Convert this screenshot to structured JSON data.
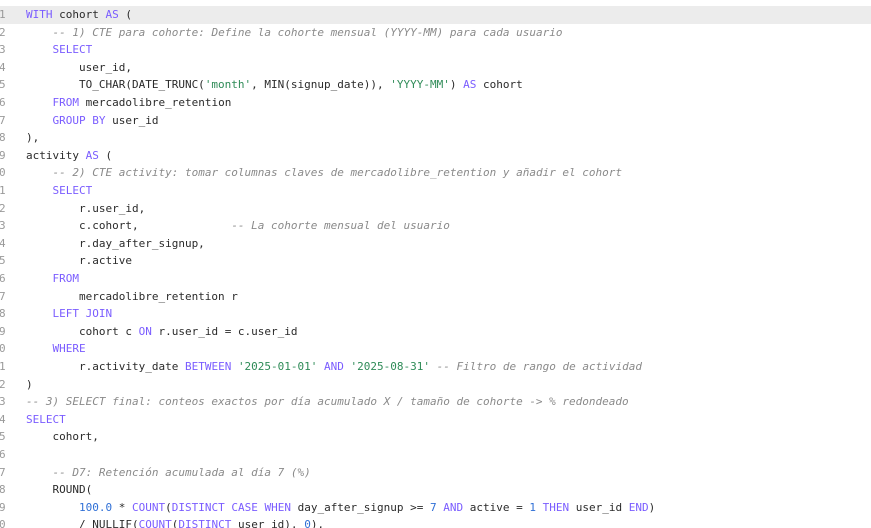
{
  "editor": {
    "current_line": 0,
    "lines": [
      {
        "num": "1",
        "tokens": [
          {
            "t": "kw",
            "v": "WITH"
          },
          {
            "t": "plain",
            "v": " cohort "
          },
          {
            "t": "kw",
            "v": "AS"
          },
          {
            "t": "plain",
            "v": " ("
          }
        ]
      },
      {
        "num": "2",
        "tokens": [
          {
            "t": "plain",
            "v": "    "
          },
          {
            "t": "com",
            "v": "-- 1) CTE para cohorte: Define la cohorte mensual (YYYY-MM) para cada usuario"
          }
        ]
      },
      {
        "num": "3",
        "tokens": [
          {
            "t": "plain",
            "v": "    "
          },
          {
            "t": "kw",
            "v": "SELECT"
          }
        ]
      },
      {
        "num": "4",
        "tokens": [
          {
            "t": "plain",
            "v": "        user_id,"
          }
        ]
      },
      {
        "num": "5",
        "tokens": [
          {
            "t": "plain",
            "v": "        TO_CHAR(DATE_TRUNC("
          },
          {
            "t": "str",
            "v": "'month'"
          },
          {
            "t": "plain",
            "v": ", MIN(signup_date)), "
          },
          {
            "t": "str",
            "v": "'YYYY-MM'"
          },
          {
            "t": "plain",
            "v": ") "
          },
          {
            "t": "kw",
            "v": "AS"
          },
          {
            "t": "plain",
            "v": " cohort"
          }
        ]
      },
      {
        "num": "6",
        "tokens": [
          {
            "t": "plain",
            "v": "    "
          },
          {
            "t": "kw",
            "v": "FROM"
          },
          {
            "t": "plain",
            "v": " mercadolibre_retention"
          }
        ]
      },
      {
        "num": "7",
        "tokens": [
          {
            "t": "plain",
            "v": "    "
          },
          {
            "t": "kw",
            "v": "GROUP BY"
          },
          {
            "t": "plain",
            "v": " user_id"
          }
        ]
      },
      {
        "num": "8",
        "tokens": [
          {
            "t": "plain",
            "v": "),"
          }
        ]
      },
      {
        "num": "9",
        "tokens": [
          {
            "t": "plain",
            "v": "activity "
          },
          {
            "t": "kw",
            "v": "AS"
          },
          {
            "t": "plain",
            "v": " ("
          }
        ]
      },
      {
        "num": "0",
        "tokens": [
          {
            "t": "plain",
            "v": "    "
          },
          {
            "t": "com",
            "v": "-- 2) CTE activity: tomar columnas claves de mercadolibre_retention y añadir el cohort"
          }
        ]
      },
      {
        "num": "1",
        "tokens": [
          {
            "t": "plain",
            "v": "    "
          },
          {
            "t": "kw",
            "v": "SELECT"
          }
        ]
      },
      {
        "num": "2",
        "tokens": [
          {
            "t": "plain",
            "v": "        r.user_id,"
          }
        ]
      },
      {
        "num": "3",
        "tokens": [
          {
            "t": "plain",
            "v": "        c.cohort,              "
          },
          {
            "t": "com",
            "v": "-- La cohorte mensual del usuario"
          }
        ]
      },
      {
        "num": "4",
        "tokens": [
          {
            "t": "plain",
            "v": "        r.day_after_signup,"
          }
        ]
      },
      {
        "num": "5",
        "tokens": [
          {
            "t": "plain",
            "v": "        r.active"
          }
        ]
      },
      {
        "num": "6",
        "tokens": [
          {
            "t": "plain",
            "v": "    "
          },
          {
            "t": "kw",
            "v": "FROM"
          }
        ]
      },
      {
        "num": "7",
        "tokens": [
          {
            "t": "plain",
            "v": "        mercadolibre_retention r"
          }
        ]
      },
      {
        "num": "8",
        "tokens": [
          {
            "t": "plain",
            "v": "    "
          },
          {
            "t": "kw",
            "v": "LEFT JOIN"
          }
        ]
      },
      {
        "num": "9",
        "tokens": [
          {
            "t": "plain",
            "v": "        cohort c "
          },
          {
            "t": "kw",
            "v": "ON"
          },
          {
            "t": "plain",
            "v": " r.user_id = c.user_id"
          }
        ]
      },
      {
        "num": "0",
        "tokens": [
          {
            "t": "plain",
            "v": "    "
          },
          {
            "t": "kw",
            "v": "WHERE"
          }
        ]
      },
      {
        "num": "1",
        "tokens": [
          {
            "t": "plain",
            "v": "        r.activity_date "
          },
          {
            "t": "kw",
            "v": "BETWEEN"
          },
          {
            "t": "plain",
            "v": " "
          },
          {
            "t": "str",
            "v": "'2025-01-01'"
          },
          {
            "t": "plain",
            "v": " "
          },
          {
            "t": "kw",
            "v": "AND"
          },
          {
            "t": "plain",
            "v": " "
          },
          {
            "t": "str",
            "v": "'2025-08-31'"
          },
          {
            "t": "plain",
            "v": " "
          },
          {
            "t": "com",
            "v": "-- Filtro de rango de actividad"
          }
        ]
      },
      {
        "num": "2",
        "tokens": [
          {
            "t": "plain",
            "v": ")"
          }
        ]
      },
      {
        "num": "3",
        "tokens": [
          {
            "t": "com",
            "v": "-- 3) SELECT final: conteos exactos por día acumulado X / tamaño de cohorte -> % redondeado"
          }
        ]
      },
      {
        "num": "4",
        "tokens": [
          {
            "t": "kw",
            "v": "SELECT"
          }
        ]
      },
      {
        "num": "5",
        "tokens": [
          {
            "t": "plain",
            "v": "    cohort,"
          }
        ]
      },
      {
        "num": "6",
        "tokens": [
          {
            "t": "plain",
            "v": ""
          }
        ]
      },
      {
        "num": "7",
        "tokens": [
          {
            "t": "plain",
            "v": "    "
          },
          {
            "t": "com",
            "v": "-- D7: Retención acumulada al día 7 (%)"
          }
        ]
      },
      {
        "num": "8",
        "tokens": [
          {
            "t": "plain",
            "v": "    ROUND("
          }
        ]
      },
      {
        "num": "9",
        "tokens": [
          {
            "t": "plain",
            "v": "        "
          },
          {
            "t": "num",
            "v": "100.0"
          },
          {
            "t": "plain",
            "v": " * "
          },
          {
            "t": "kw",
            "v": "COUNT"
          },
          {
            "t": "plain",
            "v": "("
          },
          {
            "t": "kw",
            "v": "DISTINCT CASE WHEN"
          },
          {
            "t": "plain",
            "v": " day_after_signup >= "
          },
          {
            "t": "num",
            "v": "7"
          },
          {
            "t": "plain",
            "v": " "
          },
          {
            "t": "kw",
            "v": "AND"
          },
          {
            "t": "plain",
            "v": " active = "
          },
          {
            "t": "num",
            "v": "1"
          },
          {
            "t": "plain",
            "v": " "
          },
          {
            "t": "kw",
            "v": "THEN"
          },
          {
            "t": "plain",
            "v": " user_id "
          },
          {
            "t": "kw",
            "v": "END"
          },
          {
            "t": "plain",
            "v": ")"
          }
        ]
      },
      {
        "num": "0",
        "tokens": [
          {
            "t": "plain",
            "v": "        / NULLIF("
          },
          {
            "t": "kw",
            "v": "COUNT"
          },
          {
            "t": "plain",
            "v": "("
          },
          {
            "t": "kw",
            "v": "DISTINCT"
          },
          {
            "t": "plain",
            "v": " user_id), "
          },
          {
            "t": "num",
            "v": "0"
          },
          {
            "t": "plain",
            "v": "),"
          }
        ]
      }
    ]
  },
  "colors": {
    "keyword": "#7a5cff",
    "string": "#2e8b57",
    "number": "#2f6fd6",
    "comment": "#8a8a8a",
    "line_number": "#9a9a9a",
    "current_line_bg": "#ececec"
  }
}
